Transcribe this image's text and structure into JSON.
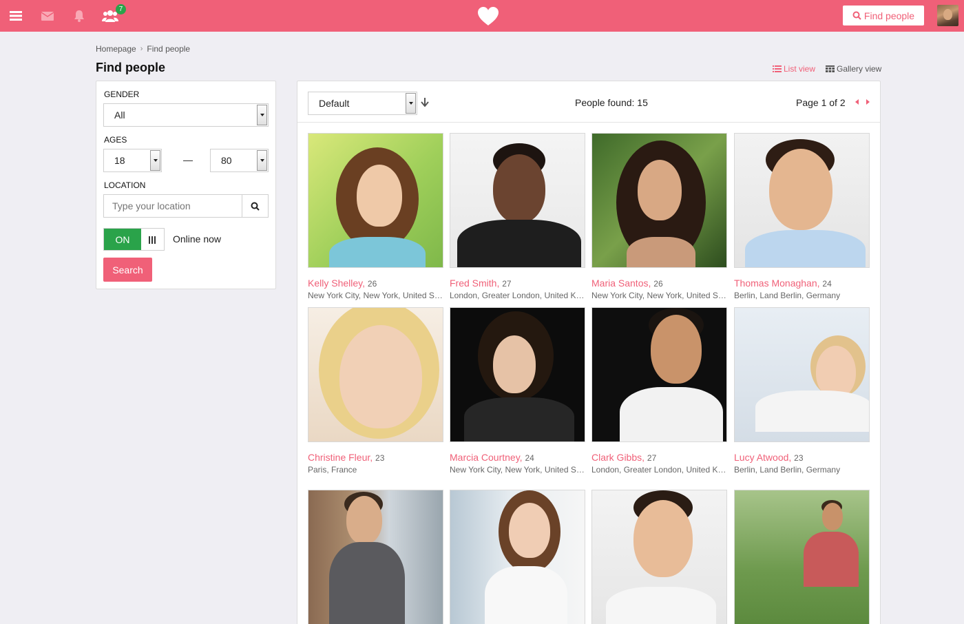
{
  "topbar": {
    "notification_count": "7",
    "find_button_label": "Find people",
    "colors": {
      "brand": "#f06078",
      "badge": "#2aa34a"
    }
  },
  "breadcrumb": {
    "home": "Homepage",
    "current": "Find people"
  },
  "page_title": "Find people",
  "views": {
    "list": "List view",
    "gallery": "Gallery view"
  },
  "filter": {
    "gender_label": "GENDER",
    "gender_value": "All",
    "ages_label": "AGES",
    "age_min": "18",
    "age_max": "80",
    "location_label": "LOCATION",
    "location_placeholder": "Type your location",
    "toggle_on": "ON",
    "online_label": "Online now",
    "search_button": "Search"
  },
  "results": {
    "sort_value": "Default",
    "people_found": "People found: 15",
    "page_info": "Page 1 of 2",
    "people": [
      {
        "name": "Kelly Shelley",
        "age": "26",
        "location": "New York City, New York, United States"
      },
      {
        "name": "Fred Smith",
        "age": "27",
        "location": "London, Greater London, United Kingdom"
      },
      {
        "name": "Maria Santos",
        "age": "26",
        "location": "New York City, New York, United States"
      },
      {
        "name": "Thomas Monaghan",
        "age": "24",
        "location": "Berlin, Land Berlin, Germany"
      },
      {
        "name": "Christine Fleur",
        "age": "23",
        "location": "Paris, France"
      },
      {
        "name": "Marcia Courtney",
        "age": "24",
        "location": "New York City, New York, United States"
      },
      {
        "name": "Clark Gibbs",
        "age": "27",
        "location": "London, Greater London, United Kingdom"
      },
      {
        "name": "Lucy Atwood",
        "age": "23",
        "location": "Berlin, Land Berlin, Germany"
      },
      {
        "name": "",
        "age": "",
        "location": ""
      },
      {
        "name": "",
        "age": "",
        "location": ""
      },
      {
        "name": "",
        "age": "",
        "location": ""
      },
      {
        "name": "",
        "age": "",
        "location": ""
      }
    ]
  }
}
